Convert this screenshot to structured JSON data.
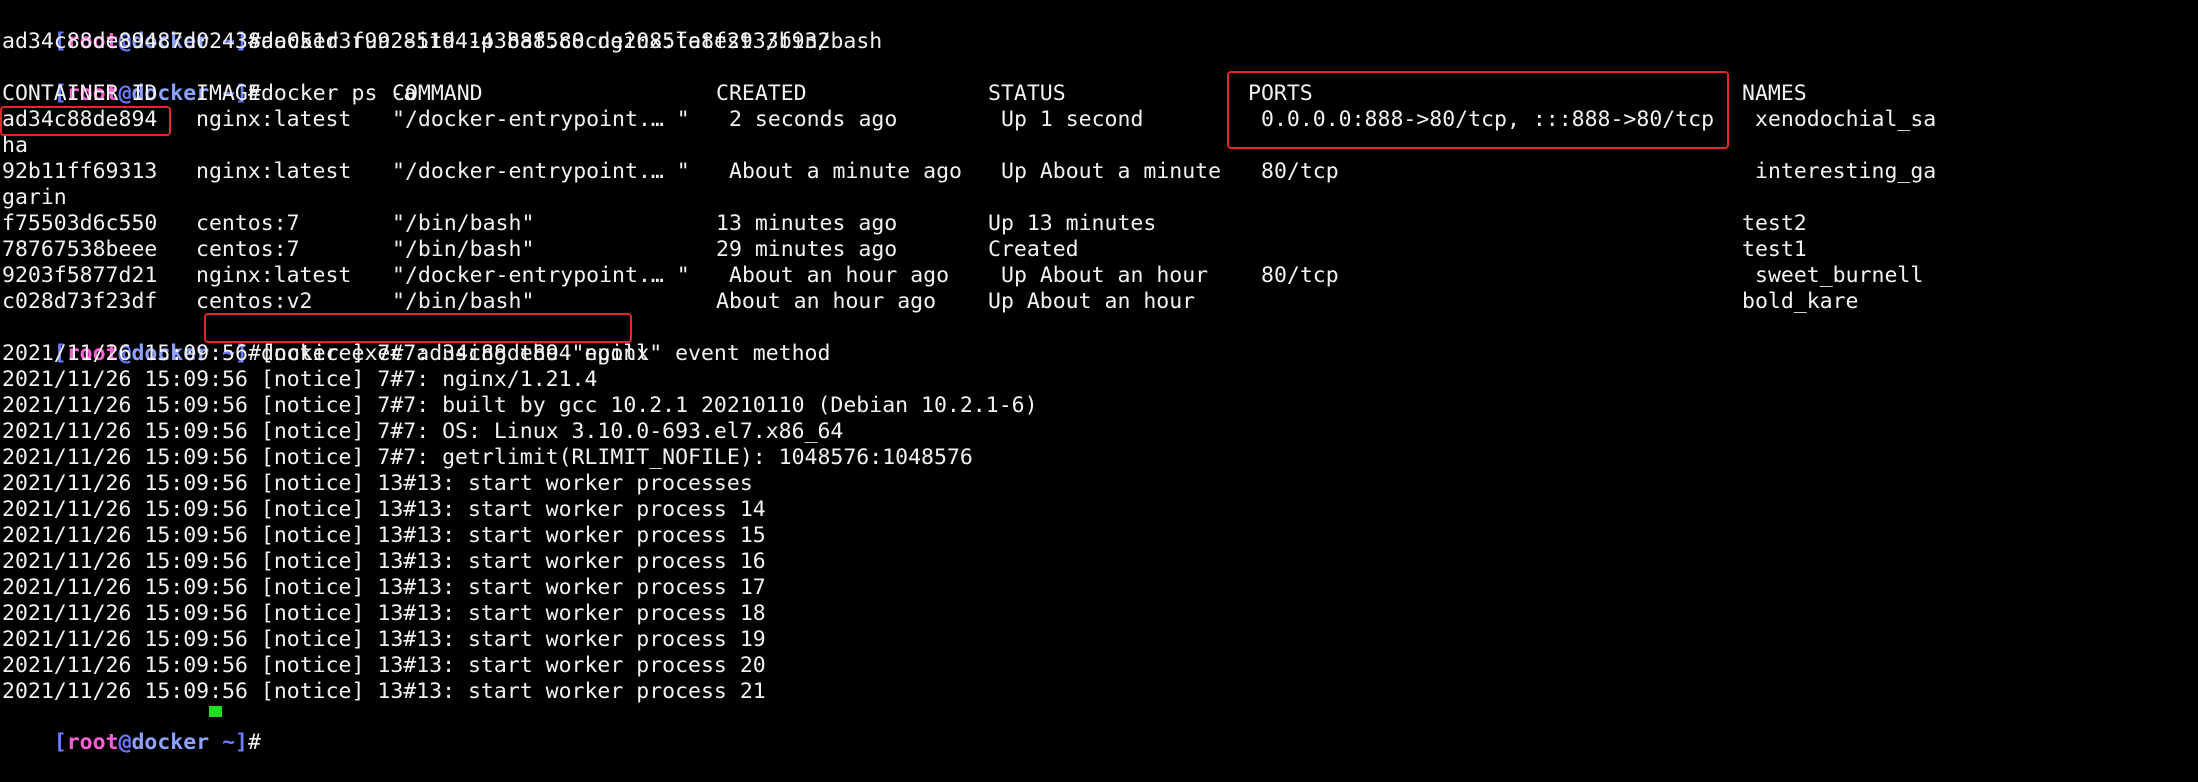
{
  "colors": {
    "background": "#000000",
    "text": "#f2f2f2",
    "prompt_bracket": "#6b7cff",
    "prompt_user": "#ff5fd7",
    "prompt_host": "#8ea2ff",
    "highlight": "#e3262b",
    "cursor": "#20e020"
  },
  "prompt": {
    "open": "[",
    "user": "root",
    "at": "@",
    "host": "docker",
    "close_path": " ~]",
    "hash": "#"
  },
  "commands": {
    "run": "docker run -itd -p 888:80 nginx:latest /bin/bash",
    "run_output": "ad34c88de89487d02438aa051d3f99285194143baf5c8cde2085fe8f2933f932",
    "ps": "docker ps -a",
    "exec": "docker exec ad34c88de894 nginx"
  },
  "ps_table": {
    "headers": {
      "container_id": "CONTAINER ID",
      "image": "IMAGE",
      "command": "COMMAND",
      "created": "CREATED",
      "status": "STATUS",
      "ports": "PORTS",
      "names": "NAMES"
    },
    "rows": [
      {
        "container_id": "ad34c88de894",
        "image": "nginx:latest",
        "command": "\"/docker-entrypoint.… \"",
        "created": "2 seconds ago",
        "status": "Up 1 second",
        "ports": "0.0.0.0:888->80/tcp, :::888->80/tcp",
        "names": "xenodochial_sa",
        "wrap": "ha"
      },
      {
        "container_id": "92b11ff69313",
        "image": "nginx:latest",
        "command": "\"/docker-entrypoint.… \"",
        "created": "About a minute ago",
        "status": "Up About a minute",
        "ports": "80/tcp",
        "names": "interesting_ga",
        "wrap": "garin"
      },
      {
        "container_id": "f75503d6c550",
        "image": "centos:7",
        "command": "\"/bin/bash\"",
        "created": "13 minutes ago",
        "status": "Up 13 minutes",
        "ports": "",
        "names": "test2"
      },
      {
        "container_id": "78767538beee",
        "image": "centos:7",
        "command": "\"/bin/bash\"",
        "created": "29 minutes ago",
        "status": "Created",
        "ports": "",
        "names": "test1"
      },
      {
        "container_id": "9203f5877d21",
        "image": "nginx:latest",
        "command": "\"/docker-entrypoint.… \"",
        "created": "About an hour ago",
        "status": "Up About an hour",
        "ports": "80/tcp",
        "names": "sweet_burnell"
      },
      {
        "container_id": "c028d73f23df",
        "image": "centos:v2",
        "command": "\"/bin/bash\"",
        "created": "About an hour ago",
        "status": "Up About an hour",
        "ports": "",
        "names": "bold_kare"
      }
    ]
  },
  "nginx_log": [
    "2021/11/26 15:09:56 [notice] 7#7: using the \"epoll\" event method",
    "2021/11/26 15:09:56 [notice] 7#7: nginx/1.21.4",
    "2021/11/26 15:09:56 [notice] 7#7: built by gcc 10.2.1 20210110 (Debian 10.2.1-6)",
    "2021/11/26 15:09:56 [notice] 7#7: OS: Linux 3.10.0-693.el7.x86_64",
    "2021/11/26 15:09:56 [notice] 7#7: getrlimit(RLIMIT_NOFILE): 1048576:1048576",
    "2021/11/26 15:09:56 [notice] 13#13: start worker processes",
    "2021/11/26 15:09:56 [notice] 13#13: start worker process 14",
    "2021/11/26 15:09:56 [notice] 13#13: start worker process 15",
    "2021/11/26 15:09:56 [notice] 13#13: start worker process 16",
    "2021/11/26 15:09:56 [notice] 13#13: start worker process 17",
    "2021/11/26 15:09:56 [notice] 13#13: start worker process 18",
    "2021/11/26 15:09:56 [notice] 13#13: start worker process 19",
    "2021/11/26 15:09:56 [notice] 13#13: start worker process 20",
    "2021/11/26 15:09:56 [notice] 13#13: start worker process 21"
  ]
}
